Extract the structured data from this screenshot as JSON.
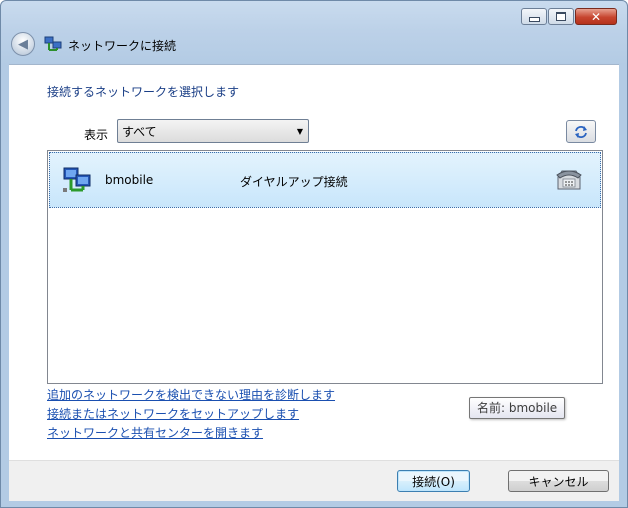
{
  "window": {
    "title": "ネットワークに接続",
    "controls": {
      "minimize": "minimize",
      "maximize": "maximize",
      "close": "✕"
    }
  },
  "instruction": "接続するネットワークを選択します",
  "filter": {
    "label": "表示",
    "selected": "すべて"
  },
  "networks": [
    {
      "name": "bmobile",
      "type": "ダイヤルアップ接続",
      "icon": "dialup-network-icon",
      "status_icon": "telephone-icon"
    }
  ],
  "links": [
    "追加のネットワークを検出できない理由を診断します",
    "接続またはネットワークをセットアップします",
    "ネットワークと共有センターを開きます"
  ],
  "tooltip": "名前: bmobile",
  "buttons": {
    "connect": "接続(O)",
    "cancel": "キャンセル"
  },
  "colors": {
    "link": "#1a4fb0",
    "instruction": "#1a3e86",
    "selection": "#c8e6fb",
    "close": "#c7452f"
  }
}
